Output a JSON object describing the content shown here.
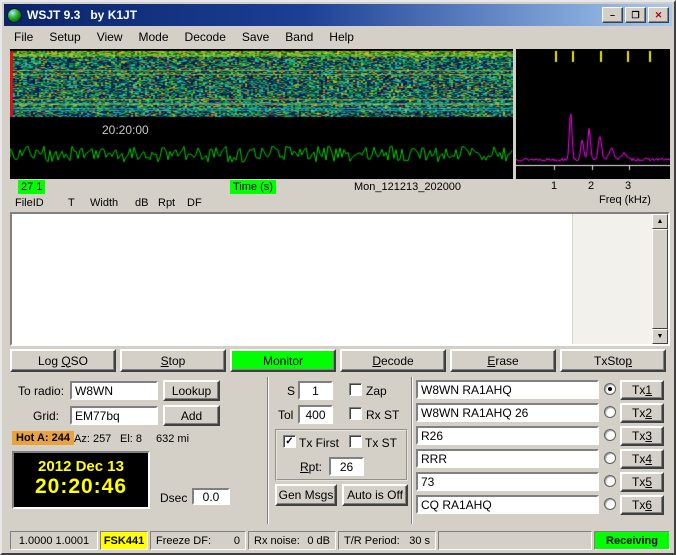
{
  "window": {
    "title": "WSJT 9.3   by K1JT"
  },
  "icons": {
    "minimize": "–",
    "maximize": "❐",
    "close": "✕",
    "scroll_up": "▲",
    "scroll_down": "▼",
    "check": "✓"
  },
  "menu": {
    "items": [
      "File",
      "Setup",
      "View",
      "Mode",
      "Decode",
      "Save",
      "Band",
      "Help"
    ]
  },
  "display": {
    "time_label": "20:20:00",
    "status_badge": "27 1",
    "axis_badge": "Time (s)",
    "filename": "Mon_121213_202000",
    "freq_ticks": [
      "1",
      "2",
      "3"
    ],
    "freq_axis": "Freq (kHz)"
  },
  "decode": {
    "columns": [
      "FileID",
      "T",
      "Width",
      "dB",
      "Rpt",
      "DF"
    ],
    "text": ""
  },
  "actions": [
    {
      "pre": "Log ",
      "key": "Q",
      "post": "SO"
    },
    {
      "pre": "",
      "key": "S",
      "post": "top"
    },
    {
      "pre": "Monitor",
      "key": "",
      "post": ""
    },
    {
      "pre": "",
      "key": "D",
      "post": "ecode"
    },
    {
      "pre": "",
      "key": "E",
      "post": "rase"
    },
    {
      "pre": "TxSto",
      "key": "p",
      "post": ""
    }
  ],
  "station": {
    "to_radio_label": "To radio:",
    "to_radio": "W8WN",
    "lookup_label": "Lookup",
    "grid_label": "Grid:",
    "grid": "EM77bq",
    "add_label": "Add",
    "hot_badge": "Hot A: 244",
    "azimuth": "Az: 257",
    "elevation": "El: 8",
    "distance": "632 mi",
    "clock_date": "2012 Dec 13",
    "clock_time": "20:20:46",
    "dsec_label": "Dsec",
    "dsec_value": "0.0"
  },
  "params": {
    "s_label": "S",
    "s_value": "1",
    "zap_label": "Zap",
    "zap_checked": false,
    "tol_label": "Tol",
    "tol_value": "400",
    "rx_st_label": "Rx ST",
    "rx_st_checked": false,
    "tx_first_label": "Tx First",
    "tx_first_checked": true,
    "tx_st_label": "Tx ST",
    "tx_st_checked": false,
    "rpt_key": "R",
    "rpt_rest": "pt:",
    "rpt_value": "26",
    "gen_msgs_label": "Gen Msgs",
    "auto_label": "Auto is Off"
  },
  "tx": {
    "selected": "Tx1",
    "rows": [
      {
        "message": "W8WN RA1AHQ",
        "pre": "Tx",
        "key": "1"
      },
      {
        "message": "W8WN RA1AHQ 26",
        "pre": "Tx",
        "key": "2"
      },
      {
        "message": "R26",
        "pre": "Tx",
        "key": "3"
      },
      {
        "message": "RRR",
        "pre": "Tx",
        "key": "4"
      },
      {
        "message": "73",
        "pre": "Tx",
        "key": "5"
      },
      {
        "message": "CQ RA1AHQ",
        "pre": "Tx",
        "key": "6"
      }
    ]
  },
  "status": {
    "dial_freqs": "1.0000 1.0001",
    "mode": "FSK441",
    "freeze_label": "Freeze DF:",
    "freeze_value": "0",
    "noise_label": "Rx noise:",
    "noise_value": "0 dB",
    "period_label": "T/R Period:",
    "period_value": "30 s",
    "rx_state": "Receiving"
  },
  "colors": {
    "active_green": "#00ff00",
    "mode_yellow": "#ffff00",
    "hot_orange": "#e8a33d",
    "clock_text": "#ffff00",
    "spectrum_trace": "#ff00ff",
    "waveform_trace": "#00cc00",
    "titlebar_start": "#0a246a",
    "titlebar_end": "#a6caf0"
  }
}
